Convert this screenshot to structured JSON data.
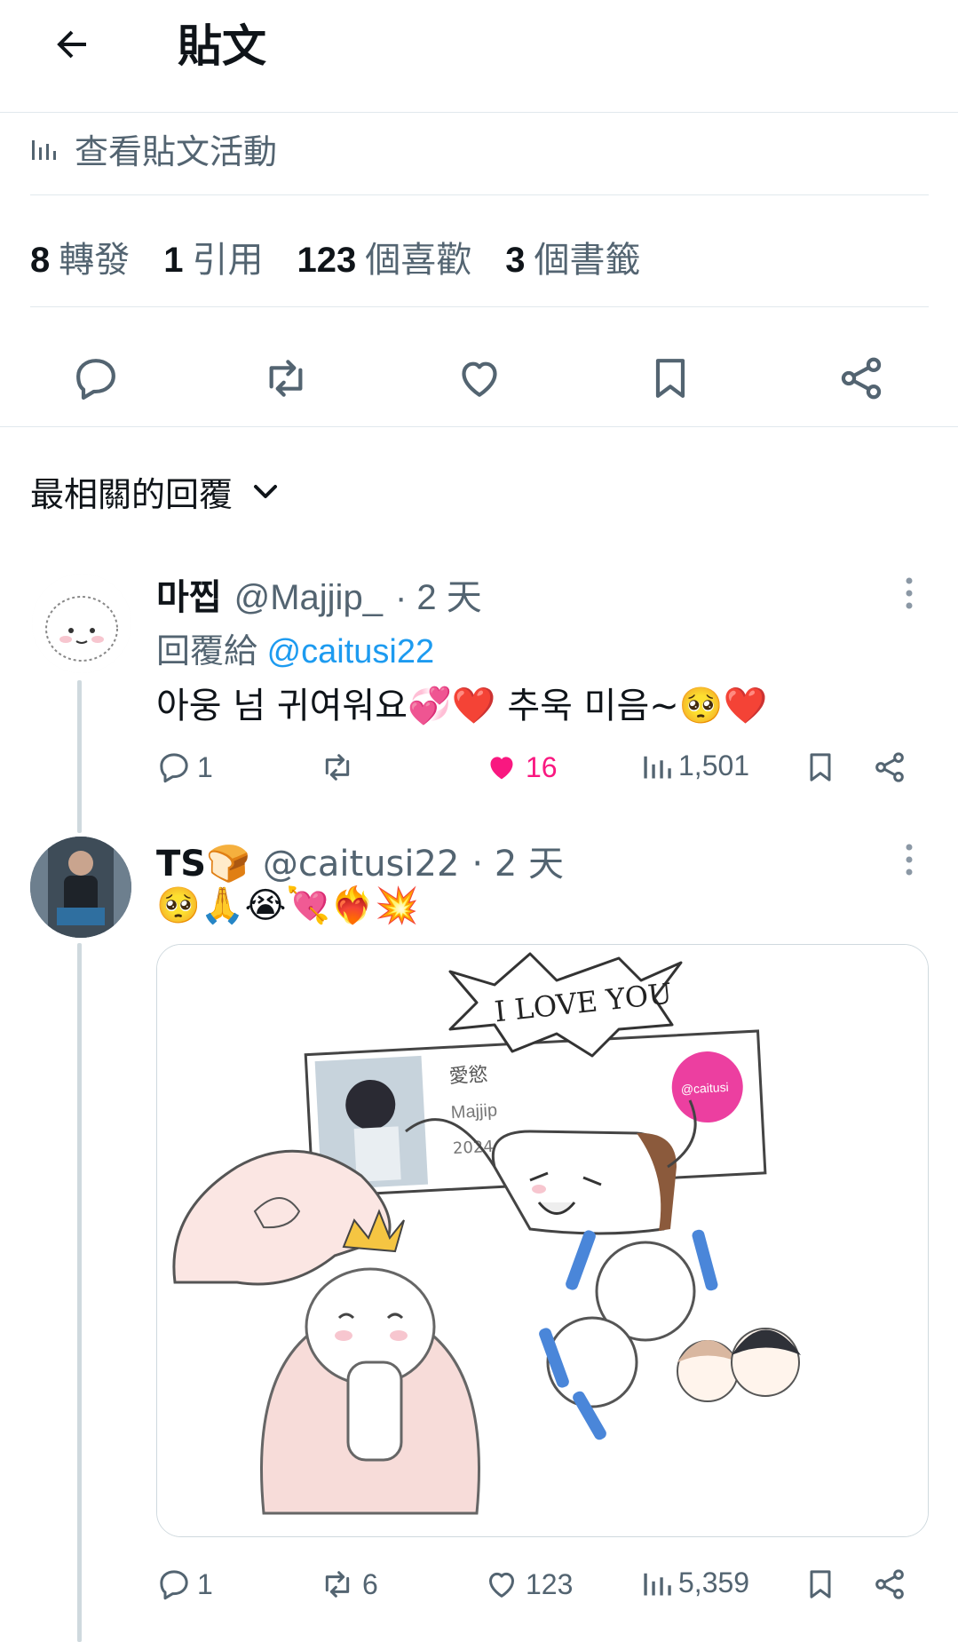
{
  "header": {
    "title": "貼文"
  },
  "activity": {
    "label": "查看貼文活動"
  },
  "stats": [
    {
      "value": "8",
      "label": "轉發"
    },
    {
      "value": "1",
      "label": "引用"
    },
    {
      "value": "123",
      "label": "個喜歡"
    },
    {
      "value": "3",
      "label": "個書籤"
    }
  ],
  "sort": {
    "label": "最相關的回覆"
  },
  "replies": [
    {
      "name": "마찝",
      "handle": "@Majjip_",
      "time": "· 2 天",
      "reply_to_prefix": "回覆給",
      "reply_to_handle": "@caitusi22",
      "text": "아웅 넘 귀여워요💞❤️ 추욱 미음~🥺❤️",
      "counts": {
        "replies": "1",
        "reposts": "",
        "likes": "16",
        "views": "1,501"
      },
      "liked": true
    },
    {
      "name": "TS🍞",
      "handle": "@caitusi22",
      "time": "· 2 天",
      "text": "🥺🙏😭💘❤️‍🔥💥",
      "media": {
        "speech": "I LOVE YOU",
        "card_title": "愛慾",
        "card_author": "Majjip",
        "card_date": "2024.08.31 更新"
      },
      "counts": {
        "replies": "1",
        "reposts": "6",
        "likes": "123",
        "views": "5,359"
      },
      "liked": false
    }
  ],
  "colors": {
    "accent": "#1d9bf0",
    "like": "#f91880",
    "muted": "#536471",
    "divider": "#e1e8ed"
  }
}
